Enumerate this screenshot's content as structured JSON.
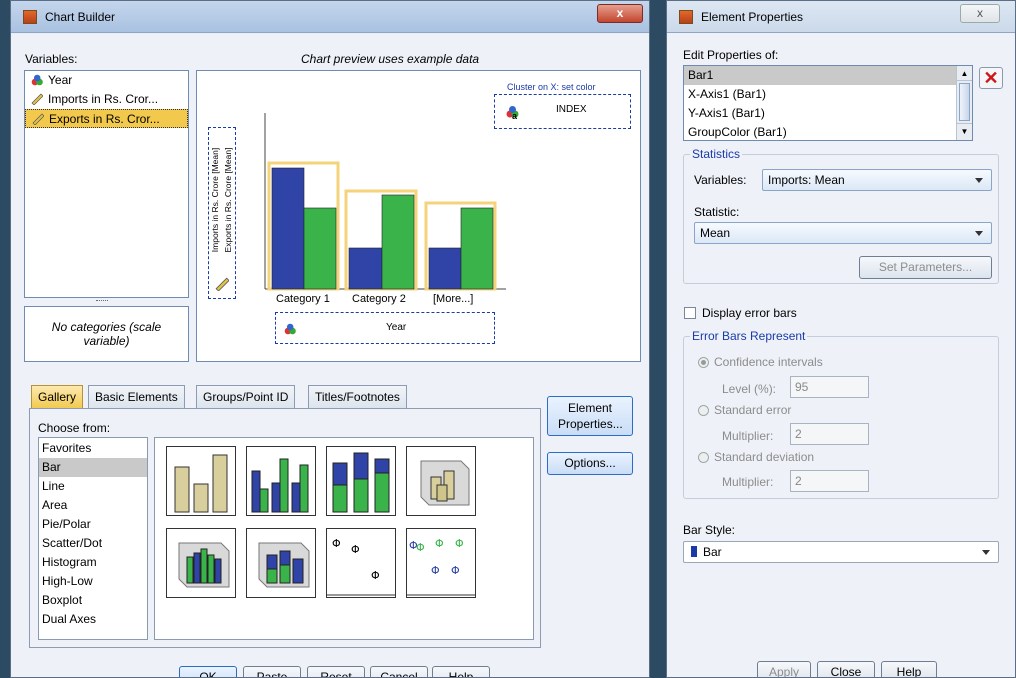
{
  "left_window": {
    "title": "Chart Builder",
    "close": "x"
  },
  "variables": {
    "label": "Variables:",
    "items": [
      "Year",
      "Imports in Rs. Cror...",
      "Exports in Rs. Cror..."
    ],
    "no_cat": "No categories (scale variable)"
  },
  "preview": {
    "caption": "Chart preview uses example data",
    "cluster_label": "Cluster on X: set color",
    "cluster_var": "INDEX",
    "y_label_1": "Imports in Rs. Crore [Mean]",
    "y_label_2": "Exports in Rs. Crore [Mean]",
    "categories": [
      "Category 1",
      "Category 2",
      "[More...]"
    ],
    "x_var": "Year"
  },
  "tabs": [
    "Gallery",
    "Basic Elements",
    "Groups/Point ID",
    "Titles/Footnotes"
  ],
  "gallery": {
    "choose_label": "Choose from:",
    "items": [
      "Favorites",
      "Bar",
      "Line",
      "Area",
      "Pie/Polar",
      "Scatter/Dot",
      "Histogram",
      "High-Low",
      "Boxplot",
      "Dual Axes"
    ],
    "selected": "Bar"
  },
  "side_buttons": {
    "element_properties": "Element Properties...",
    "options": "Options..."
  },
  "bottom_buttons": [
    "OK",
    "Paste",
    "Reset",
    "Cancel",
    "Help"
  ],
  "right_window": {
    "title": "Element Properties",
    "close": "x"
  },
  "edit_props": {
    "label": "Edit Properties of:",
    "items": [
      "Bar1",
      "X-Axis1 (Bar1)",
      "Y-Axis1 (Bar1)",
      "GroupColor (Bar1)"
    ]
  },
  "statistics": {
    "group": "Statistics",
    "variables_label": "Variables:",
    "variables_value": "Imports: Mean",
    "statistic_label": "Statistic:",
    "statistic_value": "Mean",
    "set_params": "Set Parameters..."
  },
  "error_bars": {
    "display_label": "Display error bars",
    "group": "Error Bars Represent",
    "ci": "Confidence intervals",
    "level_label": "Level (%):",
    "level_value": "95",
    "se": "Standard error",
    "se_mult_label": "Multiplier:",
    "se_mult_value": "2",
    "sd": "Standard deviation",
    "sd_mult_label": "Multiplier:",
    "sd_mult_value": "2"
  },
  "bar_style": {
    "label": "Bar Style:",
    "value": "Bar"
  },
  "right_buttons": [
    "Apply",
    "Close",
    "Help"
  ],
  "colors": {
    "bar_blue": "#2f44a6",
    "bar_green": "#3ab44a",
    "select_gold": "#f2c94c",
    "accent_blue": "#1a3aa8"
  }
}
